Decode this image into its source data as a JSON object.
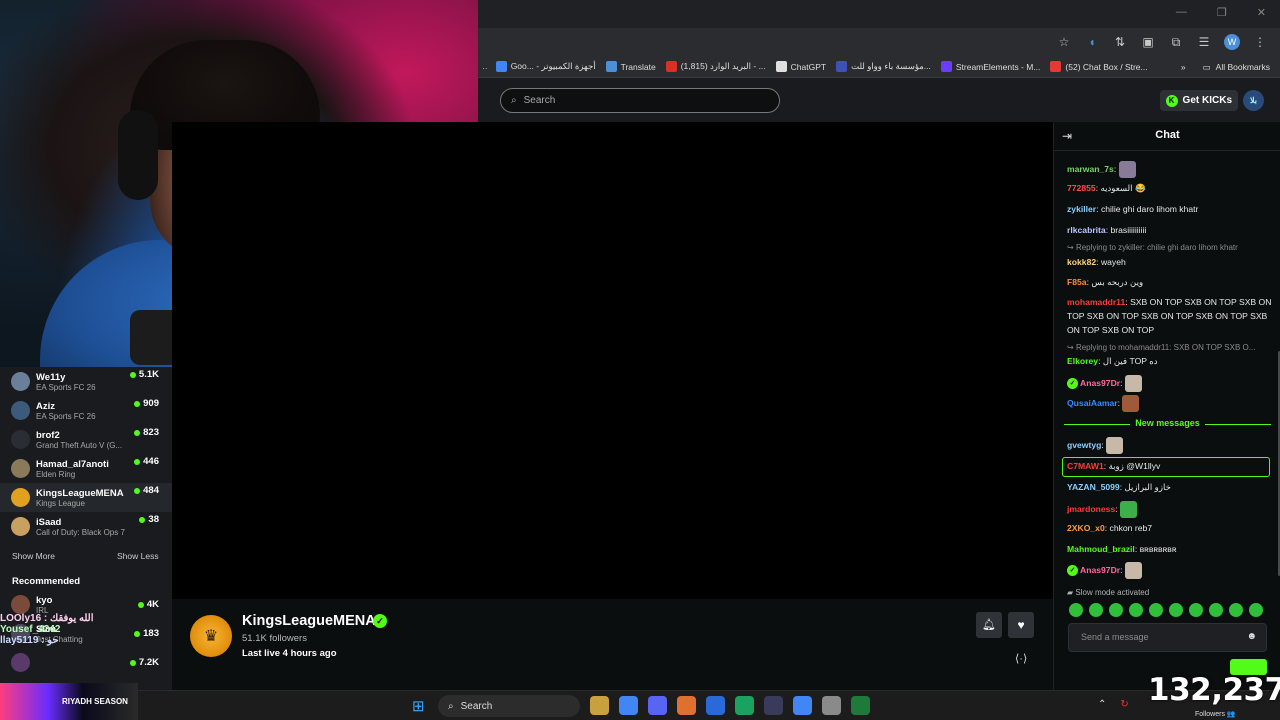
{
  "browser": {
    "window_controls": [
      "—",
      "❐",
      "✕"
    ],
    "bookmarks": [
      {
        "label": "Goo... - أجهزة الكمبيوتر",
        "color": "#4285f4"
      },
      {
        "label": "Translate",
        "color": "#4a8fd8"
      },
      {
        "label": "(1,815) البريد الوارد - ...",
        "color": "#d93025"
      },
      {
        "label": "ChatGPT",
        "color": "#e0e0e0"
      },
      {
        "label": "مؤسسة باء وواو للت...",
        "color": "#3f51b5"
      },
      {
        "label": "StreamElements - M...",
        "color": "#6a3cff"
      },
      {
        "label": "(52) Chat Box / Stre...",
        "color": "#e53935"
      }
    ],
    "all_bookmarks": "All Bookmarks"
  },
  "kick_header": {
    "search_placeholder": "Search",
    "get_kicks": "Get KICKs",
    "avatar_text": "بلا"
  },
  "following": [
    {
      "name": "We11y",
      "game": "EA Sports FC 26",
      "viewers": "5.1K",
      "color": "#6a7f9a"
    },
    {
      "name": "Aziz",
      "game": "EA Sports FC 26",
      "viewers": "909",
      "color": "#3c5a7a"
    },
    {
      "name": "brof2",
      "game": "Grand Theft Auto V (G...",
      "viewers": "823",
      "color": "#2a2d33"
    },
    {
      "name": "Hamad_al7anoti",
      "game": "Elden Ring",
      "viewers": "446",
      "color": "#8a7a5a"
    },
    {
      "name": "KingsLeagueMENA",
      "game": "Kings League",
      "viewers": "484",
      "color": "#e0a020"
    },
    {
      "name": "iSaad",
      "game": "Call of Duty: Black Ops 7",
      "viewers": "38",
      "color": "#c8a060"
    }
  ],
  "sidebar": {
    "show_more": "Show More",
    "show_less": "Show Less",
    "recommended_title": "Recommended"
  },
  "recommended": [
    {
      "name": "kyo",
      "game": "IRL",
      "viewers": "4K",
      "color": "#7a4a3a"
    },
    {
      "name": "Slim",
      "game": "Just Chatting",
      "viewers": "183",
      "color": "#4a4a5a"
    },
    {
      "name": "",
      "game": "",
      "viewers": "7.2K",
      "color": "#5a3a6a"
    }
  ],
  "overlay_names": [
    "LOOly16 : الله يوفقك",
    "Yousef_4242",
    "llay5119 : حو"
  ],
  "riyadh_badge": "RIYADH SEASON",
  "channel": {
    "name": "KingsLeagueMENA",
    "followers": "51.1K followers",
    "last_live": "Last live 4 hours ago"
  },
  "chat": {
    "title": "Chat",
    "new_messages_label": "New messages",
    "slow_mode": "Slow mode activated",
    "input_placeholder": "Send a message",
    "replies": [
      "Replying to zykiller: chilie ghi daro lihom khatr",
      "Replying to mohamaddr11: SXB ON TOP SXB O..."
    ],
    "messages": [
      {
        "user": "marwan_7s",
        "color": "#7bd16b",
        "text": "",
        "emote": "#8a7a9a"
      },
      {
        "user": "772855",
        "color": "#ff4a4a",
        "text": "السعوديه 😂"
      },
      {
        "user": "zykiller",
        "color": "#8ad0ff",
        "text": "chilie ghi daro lihom khatr"
      },
      {
        "user": "rlkcabrita",
        "color": "#b8c8ff",
        "text": "brasiiiiiiiiii"
      },
      {
        "user": "kokk82",
        "color": "#ffd27a",
        "text": "wayeh"
      },
      {
        "user": "F85a",
        "color": "#ff8a3a",
        "text": "وين دربحه بس"
      },
      {
        "user": "mohamaddr11",
        "color": "#ff3a3a",
        "text": "SXB ON TOP SXB ON TOP SXB ON TOP SXB ON TOP SXB ON TOP SXB ON TOP SXB ON TOP SXB ON TOP"
      },
      {
        "user": "Elkorey",
        "color": "#53fc18",
        "text": "فين ال TOP ده"
      },
      {
        "user": "Anas97Dr",
        "color": "#ff6a9a",
        "text": "",
        "emote": "#c8b8a8",
        "badge": true
      },
      {
        "user": "QusaiAamar",
        "color": "#3a8aff",
        "text": "",
        "emote": "#a05a3a"
      },
      {
        "user": "gvewtyg",
        "color": "#8ad0ff",
        "text": "",
        "emote": "#c8b8a8"
      },
      {
        "user": "C7MAW1",
        "color": "#ff3a3a",
        "text": "زوبة @W1llyv"
      },
      {
        "user": "YAZAN_5099",
        "color": "#8ad0ff",
        "text": "خازو البرازيل"
      },
      {
        "user": "jmardoness",
        "color": "#ff3a3a",
        "text": "",
        "emote": "#3aaf4a"
      },
      {
        "user": "2XKO_x0",
        "color": "#ff9a3a",
        "text": "chkon reb7"
      },
      {
        "user": "Mahmoud_brazil",
        "color": "#53fc18",
        "text": "ʙʀʙʀʙʀʙʀ"
      },
      {
        "user": "Anas97Dr",
        "color": "#ff6a9a",
        "text": "",
        "emote": "#c8b8a8",
        "badge": true
      }
    ]
  },
  "taskbar": {
    "search": "Search",
    "icons": [
      "#c8a040",
      "#4285f4",
      "#5865f2",
      "#e07030",
      "#2a6ad8",
      "#1aa260",
      "#3a3a5a",
      "#4285f4",
      "#8a8a8a",
      "#1e7a3a"
    ]
  },
  "viewer_overlay": {
    "count": "132,237",
    "label": "Followers 👥"
  }
}
